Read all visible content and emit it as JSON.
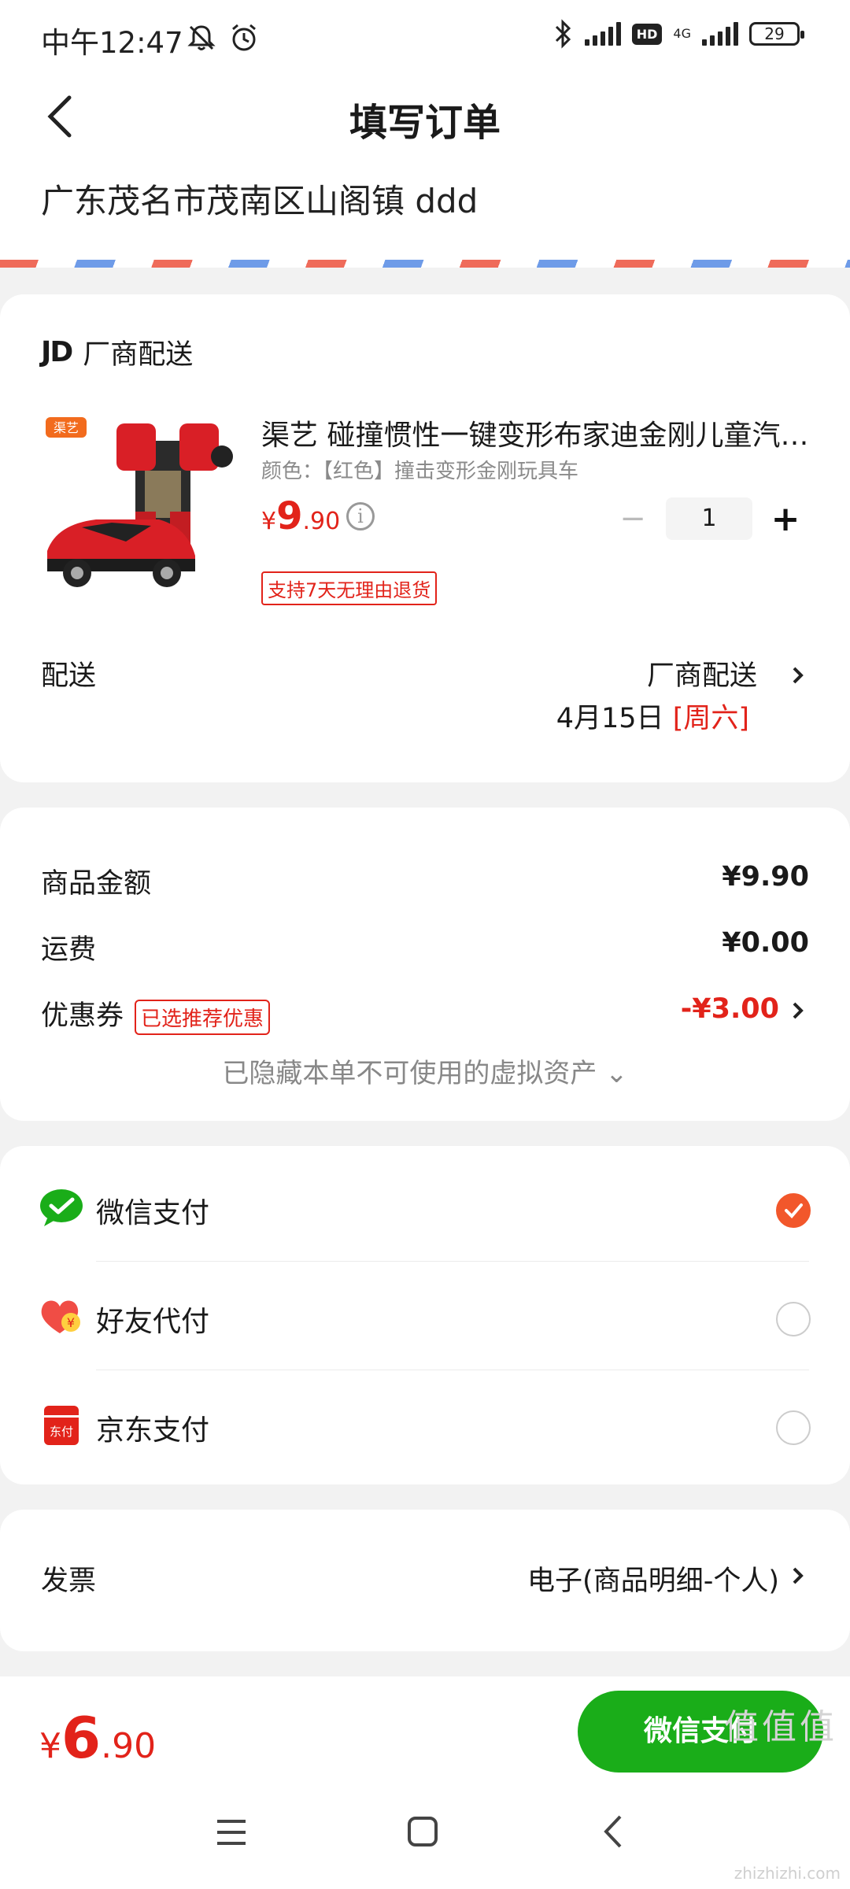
{
  "status_bar": {
    "time": "中午12:47",
    "battery": "29",
    "network": "4G",
    "hd": "HD"
  },
  "nav": {
    "title": "填写订单"
  },
  "address": "广东茂名市茂南区山阁镇 ddd",
  "order": {
    "seller_logo": "JD",
    "seller_label": "厂商配送",
    "product": {
      "brand_badge": "渠艺",
      "title": "渠艺 碰撞惯性一键变形布家迪金刚儿童汽…",
      "spec": "颜色：【红色】撞击变形金刚玩具车",
      "price_currency": "¥",
      "price_int": "9",
      "price_dec": ".90",
      "quantity": "1",
      "return_tag": "支持7天无理由退货"
    },
    "shipping": {
      "label": "配送",
      "method": "厂商配送",
      "date": "4月15日",
      "weekday": "[周六]"
    }
  },
  "summary": {
    "goods_label": "商品金额",
    "goods_value": "¥9.90",
    "freight_label": "运费",
    "freight_value": "¥0.00",
    "coupon_label": "优惠券",
    "coupon_tag": "已选推荐优惠",
    "coupon_value": "-¥3.00",
    "hidden_note": "已隐藏本单不可使用的虚拟资产 ⌄"
  },
  "payment": {
    "options": [
      {
        "label": "微信支付",
        "selected": true
      },
      {
        "label": "好友代付",
        "selected": false
      },
      {
        "label": "京东支付",
        "selected": false
      }
    ],
    "jd_icon_text": "东付"
  },
  "invoice": {
    "label": "发票",
    "value": "电子(商品明细-个人)"
  },
  "footer": {
    "total_currency": "¥",
    "total_int": "6",
    "total_dec": ".90",
    "pay_button": "微信支付"
  },
  "watermark": {
    "text": "值值值",
    "sub": "zhizhizhi.com"
  },
  "colors": {
    "accent_red": "#e2231a",
    "wechat_green": "#1aad19",
    "radio_orange": "#f2572b"
  }
}
